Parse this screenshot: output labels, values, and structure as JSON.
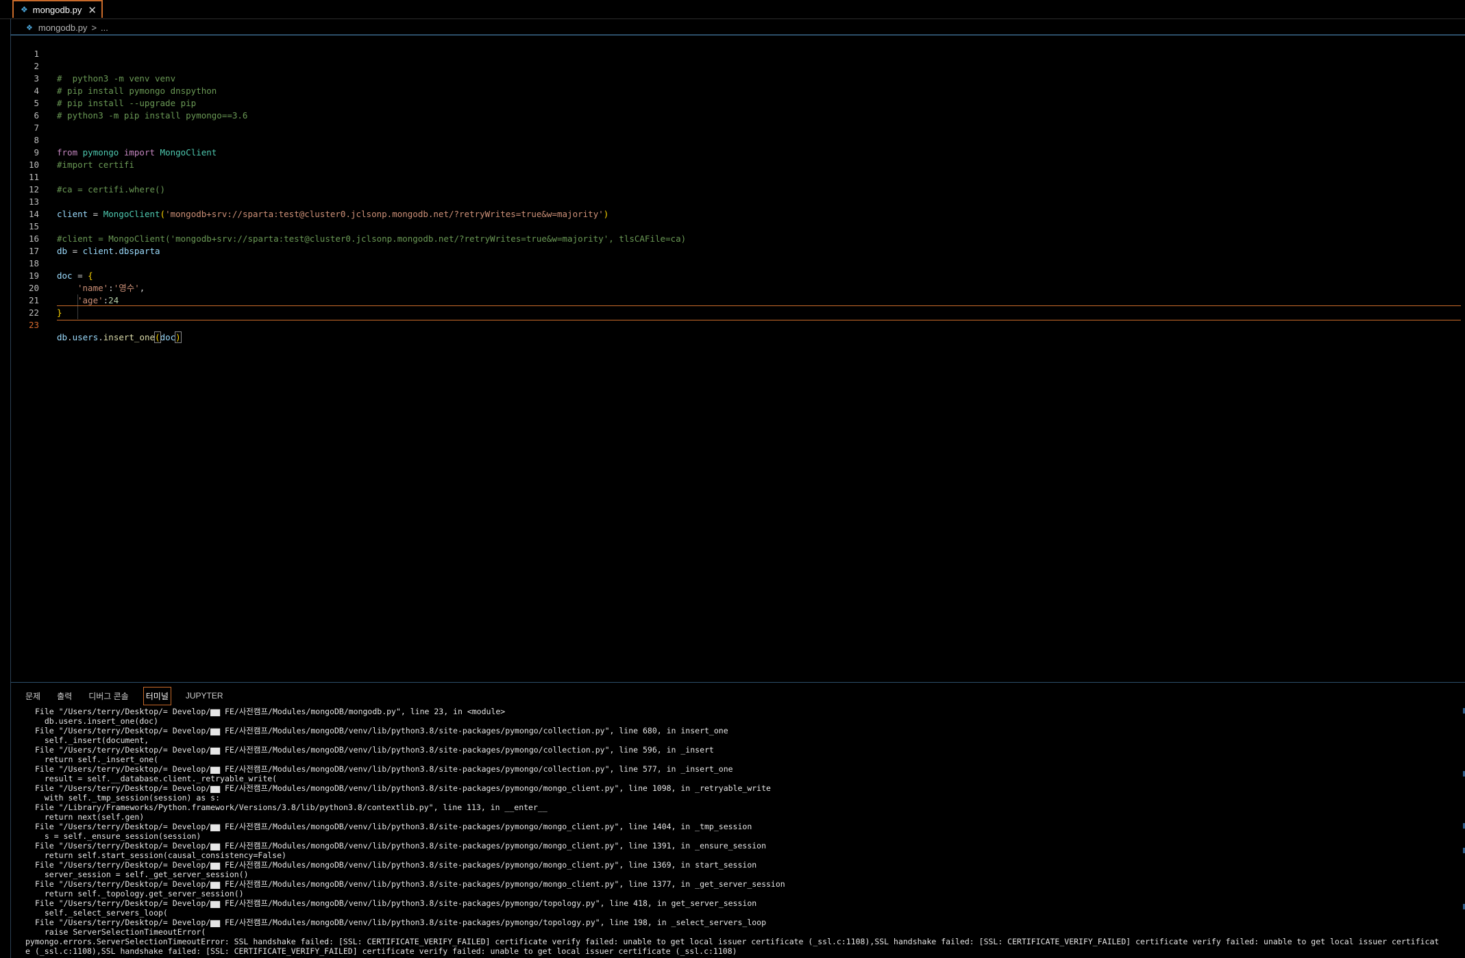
{
  "tab": {
    "filename": "mongodb.py",
    "close_symbol": "✕",
    "icon": "python-file-icon"
  },
  "breadcrumb": {
    "file": "mongodb.py",
    "separator": ">",
    "symbol": "..."
  },
  "editor": {
    "current_line": 23,
    "lines": [
      {
        "n": "1"
      },
      {
        "n": "2",
        "comment": "#  python3 -m venv venv"
      },
      {
        "n": "3",
        "comment": "# pip install pymongo dnspython"
      },
      {
        "n": "4",
        "comment": "# pip install --upgrade pip"
      },
      {
        "n": "5",
        "comment": "# python3 -m pip install pymongo==3.6"
      },
      {
        "n": "6"
      },
      {
        "n": "7"
      },
      {
        "n": "8",
        "kw1": "from",
        "mod": "pymongo",
        "kw2": "import",
        "cls": "MongoClient"
      },
      {
        "n": "9",
        "comment": "#import certifi"
      },
      {
        "n": "10"
      },
      {
        "n": "11",
        "comment": "#ca = certifi.where()"
      },
      {
        "n": "12"
      },
      {
        "n": "13",
        "var": "client",
        "op": " = ",
        "cls": "MongoClient",
        "open": "(",
        "str": "'mongodb+srv://sparta:test@cluster0.jclsonp.mongodb.net/?retryWrites=true&w=majority'",
        "close": ")"
      },
      {
        "n": "14"
      },
      {
        "n": "15",
        "comment": "#client = MongoClient('mongodb+srv://sparta:test@cluster0.jclsonp.mongodb.net/?retryWrites=true&w=majority', tlsCAFile=ca)"
      },
      {
        "n": "16",
        "var": "db",
        "op": " = ",
        "var2": "client",
        "dot": ".",
        "attr": "dbsparta"
      },
      {
        "n": "17"
      },
      {
        "n": "18",
        "var": "doc",
        "op": " = ",
        "brace": "{"
      },
      {
        "n": "19",
        "key": "'name'",
        "colon": ":",
        "val": "'영수'",
        "comma": ","
      },
      {
        "n": "20",
        "key": "'age'",
        "colon": ":",
        "num": "24"
      },
      {
        "n": "21",
        "brace": "}"
      },
      {
        "n": "22"
      },
      {
        "n": "23",
        "var": "db",
        "dot1": ".",
        "attr": "users",
        "dot2": ".",
        "fn": "insert_one",
        "open": "(",
        "arg": "doc",
        "close": ")"
      }
    ]
  },
  "panel": {
    "tabs": [
      "문제",
      "출력",
      "디버그 콘솔",
      "터미널",
      "JUPYTER"
    ],
    "active_tab": "터미널"
  },
  "terminal": {
    "lines": [
      "File \"/Users/terry/Desktop/= Develop/▆▆ FE/사전캠프/Modules/mongoDB/mongodb.py\", line 23, in <module>",
      "  db.users.insert_one(doc)",
      "File \"/Users/terry/Desktop/= Develop/▆▆ FE/사전캠프/Modules/mongoDB/venv/lib/python3.8/site-packages/pymongo/collection.py\", line 680, in insert_one",
      "  self._insert(document,",
      "File \"/Users/terry/Desktop/= Develop/▆▆ FE/사전캠프/Modules/mongoDB/venv/lib/python3.8/site-packages/pymongo/collection.py\", line 596, in _insert",
      "  return self._insert_one(",
      "File \"/Users/terry/Desktop/= Develop/▆▆ FE/사전캠프/Modules/mongoDB/venv/lib/python3.8/site-packages/pymongo/collection.py\", line 577, in _insert_one",
      "  result = self.__database.client._retryable_write(",
      "File \"/Users/terry/Desktop/= Develop/▆▆ FE/사전캠프/Modules/mongoDB/venv/lib/python3.8/site-packages/pymongo/mongo_client.py\", line 1098, in _retryable_write",
      "  with self._tmp_session(session) as s:",
      "File \"/Library/Frameworks/Python.framework/Versions/3.8/lib/python3.8/contextlib.py\", line 113, in __enter__",
      "  return next(self.gen)",
      "File \"/Users/terry/Desktop/= Develop/▆▆ FE/사전캠프/Modules/mongoDB/venv/lib/python3.8/site-packages/pymongo/mongo_client.py\", line 1404, in _tmp_session",
      "  s = self._ensure_session(session)",
      "File \"/Users/terry/Desktop/= Develop/▆▆ FE/사전캠프/Modules/mongoDB/venv/lib/python3.8/site-packages/pymongo/mongo_client.py\", line 1391, in _ensure_session",
      "  return self.start_session(causal_consistency=False)",
      "File \"/Users/terry/Desktop/= Develop/▆▆ FE/사전캠프/Modules/mongoDB/venv/lib/python3.8/site-packages/pymongo/mongo_client.py\", line 1369, in start_session",
      "  server_session = self._get_server_session()",
      "File \"/Users/terry/Desktop/= Develop/▆▆ FE/사전캠프/Modules/mongoDB/venv/lib/python3.8/site-packages/pymongo/mongo_client.py\", line 1377, in _get_server_session",
      "  return self._topology.get_server_session()",
      "File \"/Users/terry/Desktop/= Develop/▆▆ FE/사전캠프/Modules/mongoDB/venv/lib/python3.8/site-packages/pymongo/topology.py\", line 418, in get_server_session",
      "  self._select_servers_loop(",
      "File \"/Users/terry/Desktop/= Develop/▆▆ FE/사전캠프/Modules/mongoDB/venv/lib/python3.8/site-packages/pymongo/topology.py\", line 198, in _select_servers_loop",
      "  raise ServerSelectionTimeoutError("
    ],
    "error_lines": [
      "pymongo.errors.ServerSelectionTimeoutError: SSL handshake failed: [SSL: CERTIFICATE_VERIFY_FAILED] certificate verify failed: unable to get local issuer certificate (_ssl.c:1108),SSL handshake failed: [SSL: CERTIFICATE_VERIFY_FAILED] certificate verify failed: unable to get local issuer certificat",
      "e (_ssl.c:1108),SSL handshake failed: [SSL: CERTIFICATE_VERIFY_FAILED] certificate verify failed: unable to get local issuer certificate (_ssl.c:1108)"
    ]
  }
}
